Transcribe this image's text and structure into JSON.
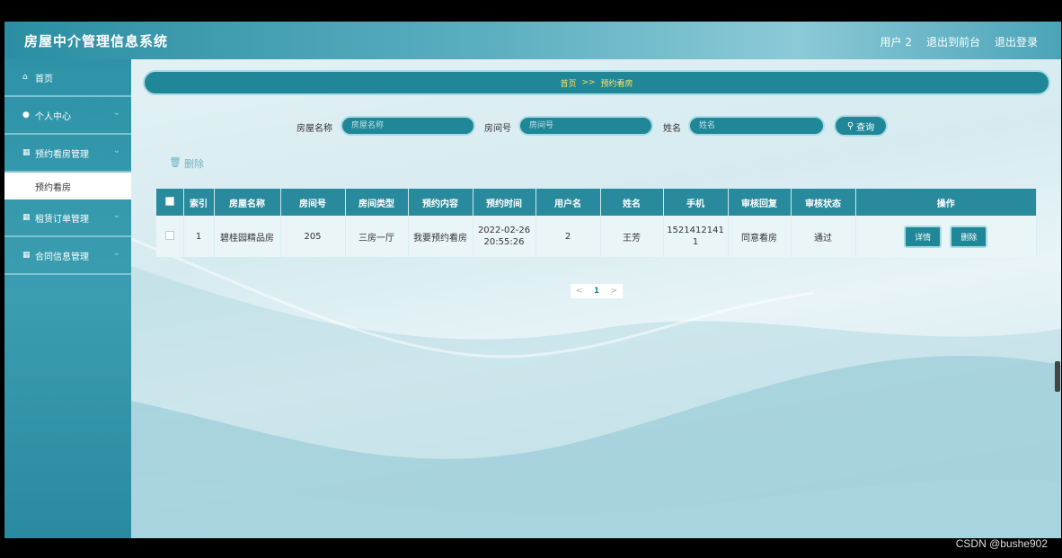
{
  "header": {
    "brand": "房屋中介管理信息系统",
    "user": "用户 2",
    "back_to_front": "退出到前台",
    "logout": "退出登录"
  },
  "sidebar": {
    "items": [
      {
        "icon": "home-icon",
        "label": "首页"
      },
      {
        "icon": "user-icon",
        "label": "个人中心"
      },
      {
        "icon": "grid-icon",
        "label": "预约看房管理"
      },
      {
        "icon": "grid-icon",
        "label": "租赁订单管理"
      },
      {
        "icon": "grid-icon",
        "label": "合同信息管理"
      }
    ],
    "submenu_active": "预约看房"
  },
  "breadcrumb": {
    "home": "首页",
    "sep": ">>",
    "current": "预约看房"
  },
  "search": {
    "house_name_label": "房屋名称",
    "house_name_placeholder": "房屋名称",
    "room_no_label": "房间号",
    "room_no_placeholder": "房间号",
    "name_label": "姓名",
    "name_placeholder": "姓名",
    "query_label": "查询"
  },
  "toolbar": {
    "delete_label": "删除"
  },
  "table": {
    "headers": [
      "索引",
      "房屋名称",
      "房间号",
      "房间类型",
      "预约内容",
      "预约时间",
      "用户名",
      "姓名",
      "手机",
      "审核回复",
      "审核状态",
      "操作"
    ],
    "rows": [
      {
        "index": "1",
        "house_name": "碧桂园精品房",
        "room_no": "205",
        "room_type": "三房一厅",
        "content": "我要预约看房",
        "date": "2022-02-26",
        "time": "20:55:26",
        "username": "2",
        "name": "王芳",
        "phone_line1": "1521412141",
        "phone_line2": "1",
        "review_reply": "同意看房",
        "review_status": "通过",
        "detail_label": "详情",
        "delete_label": "删除"
      }
    ]
  },
  "pager": {
    "prev": "<",
    "current": "1",
    "next": ">"
  },
  "watermark": "CSDN @bushe902"
}
